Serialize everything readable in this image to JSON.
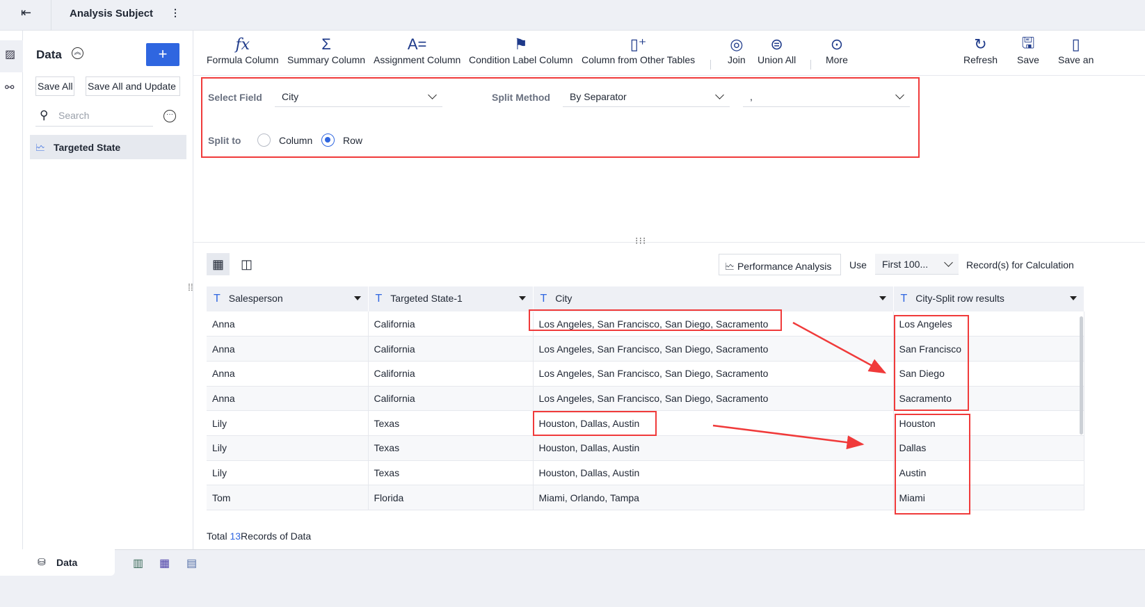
{
  "header": {
    "title": "Analysis Subject"
  },
  "sidebar": {
    "title": "Data",
    "add_label": "+",
    "save_all": "Save All",
    "save_all_update": "Save All and Update",
    "search_placeholder": "Search",
    "items": [
      {
        "label": "Targeted State"
      }
    ]
  },
  "toolbar": {
    "items": [
      {
        "label": "Formula Column",
        "icon": "fx"
      },
      {
        "label": "Summary Column",
        "icon": "Σ"
      },
      {
        "label": "Assignment Column",
        "icon": "A="
      },
      {
        "label": "Condition Label Column",
        "icon": "flag"
      },
      {
        "label": "Column from Other Tables",
        "icon": "column-add"
      },
      {
        "label": "Join",
        "icon": "join"
      },
      {
        "label": "Union All",
        "icon": "union"
      },
      {
        "label": "More",
        "icon": "more"
      }
    ],
    "refresh": "Refresh",
    "save": "Save",
    "save_and": "Save an"
  },
  "form": {
    "select_field_label": "Select Field",
    "select_field_value": "City",
    "split_method_label": "Split Method",
    "split_method_value": "By Separator",
    "separator_value": ",",
    "split_to_label": "Split to",
    "options": [
      "Column",
      "Row"
    ],
    "selected": "Row"
  },
  "grid": {
    "performance_label": "Performance Analysis",
    "use_label": "Use",
    "use_value": "First 100...",
    "calc_label": "Record(s) for Calculation",
    "columns": [
      "Salesperson",
      "Targeted State-1",
      "City",
      "City-Split row results"
    ],
    "rows": [
      [
        "Anna",
        "California",
        "Los Angeles, San Francisco, San Diego, Sacramento",
        "Los Angeles"
      ],
      [
        "Anna",
        "California",
        "Los Angeles, San Francisco, San Diego, Sacramento",
        "San Francisco"
      ],
      [
        "Anna",
        "California",
        "Los Angeles, San Francisco, San Diego, Sacramento",
        "San Diego"
      ],
      [
        "Anna",
        "California",
        "Los Angeles, San Francisco, San Diego, Sacramento",
        "Sacramento"
      ],
      [
        "Lily",
        "Texas",
        "Houston, Dallas, Austin",
        "Houston"
      ],
      [
        "Lily",
        "Texas",
        "Houston, Dallas, Austin",
        "Dallas"
      ],
      [
        "Lily",
        "Texas",
        "Houston, Dallas, Austin",
        "Austin"
      ],
      [
        "Tom",
        "Florida",
        "Miami, Orlando, Tampa",
        "Miami"
      ]
    ]
  },
  "footer": {
    "prefix": "Total",
    "count": "13",
    "suffix": "Records of Data"
  },
  "bottom": {
    "tab": "Data"
  }
}
